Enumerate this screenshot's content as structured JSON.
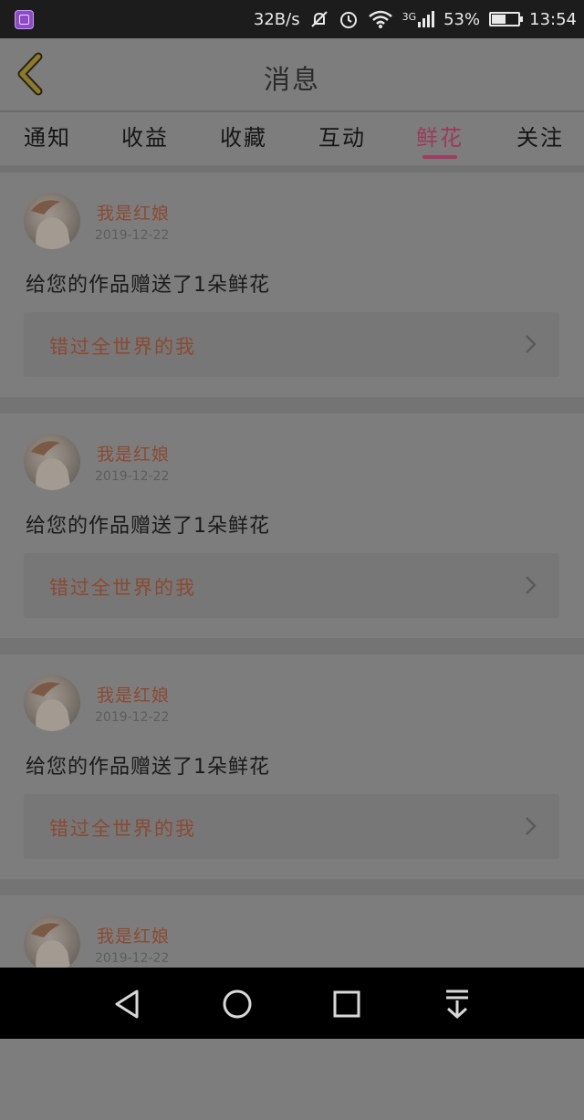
{
  "status_bar": {
    "speed": "32B/s",
    "network": "3G",
    "battery": "53%",
    "battery_level": 0.53,
    "time": "13:54"
  },
  "header": {
    "title": "消息"
  },
  "tabs": [
    {
      "label": "通知",
      "active": false
    },
    {
      "label": "收益",
      "active": false
    },
    {
      "label": "收藏",
      "active": false
    },
    {
      "label": "互动",
      "active": false
    },
    {
      "label": "鲜花",
      "active": true
    },
    {
      "label": "关注",
      "active": false
    }
  ],
  "messages": [
    {
      "user": "我是红娘",
      "date": "2019-12-22",
      "text": "给您的作品赠送了1朵鲜花",
      "work": "错过全世界的我"
    },
    {
      "user": "我是红娘",
      "date": "2019-12-22",
      "text": "给您的作品赠送了1朵鲜花",
      "work": "错过全世界的我"
    },
    {
      "user": "我是红娘",
      "date": "2019-12-22",
      "text": "给您的作品赠送了1朵鲜花",
      "work": "错过全世界的我"
    },
    {
      "user": "我是红娘",
      "date": "2019-12-22"
    }
  ],
  "colors": {
    "accent": "#a23b61",
    "name": "#8a4a32"
  }
}
